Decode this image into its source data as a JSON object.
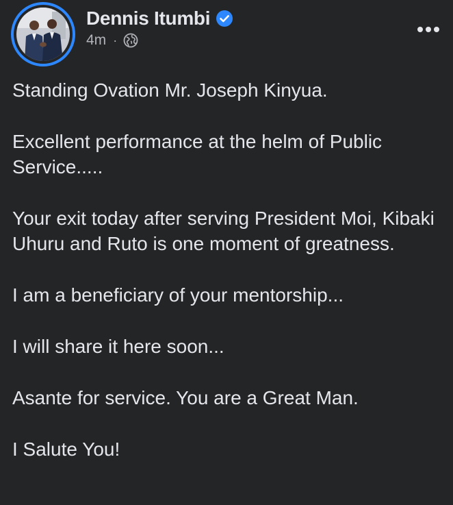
{
  "post": {
    "author": "Dennis Itumbi",
    "verified": true,
    "timestamp": "4m",
    "separator": "·",
    "audience_icon": "globe-icon",
    "more_icon": "more-dots-icon",
    "paragraphs": [
      "Standing Ovation Mr. Joseph Kinyua.",
      "Excellent performance at the helm of Public Service.....",
      "Your exit today after serving President Moi, Kibaki  Uhuru and Ruto is one moment of greatness.",
      "I am a beneficiary of your mentorship...",
      "I will share it here soon...",
      "Asante for service. You are a Great Man.",
      "I Salute You!"
    ]
  },
  "colors": {
    "background": "#242526",
    "text_primary": "#e4e6eb",
    "text_secondary": "#b0b3b8",
    "accent": "#2d88ff"
  }
}
